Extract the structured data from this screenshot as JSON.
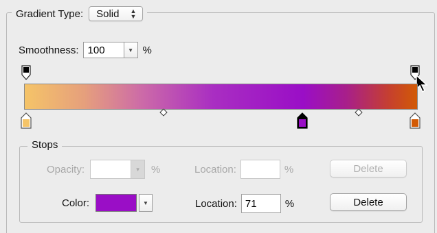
{
  "gradient_type": {
    "label": "Gradient Type:",
    "value": "Solid"
  },
  "smoothness": {
    "label": "Smoothness:",
    "value": "100",
    "unit": "%"
  },
  "gradient": {
    "color_stops": [
      {
        "location": 0,
        "color": "#f5c468"
      },
      {
        "location": 71,
        "color": "#9a0ec6",
        "selected": true
      },
      {
        "location": 100,
        "color": "#d25a05"
      }
    ],
    "opacity_stops": [
      {
        "location": 0,
        "color": "#000000"
      },
      {
        "location": 100,
        "color": "#000000"
      }
    ]
  },
  "stops": {
    "title": "Stops",
    "opacity": {
      "label": "Opacity:",
      "value": "",
      "unit": "%",
      "location_label": "Location:",
      "location_value": "",
      "location_unit": "%",
      "delete_label": "Delete"
    },
    "color": {
      "label": "Color:",
      "swatch": "#9a0ec6",
      "location_label": "Location:",
      "location_value": "71",
      "location_unit": "%",
      "delete_label": "Delete"
    }
  }
}
